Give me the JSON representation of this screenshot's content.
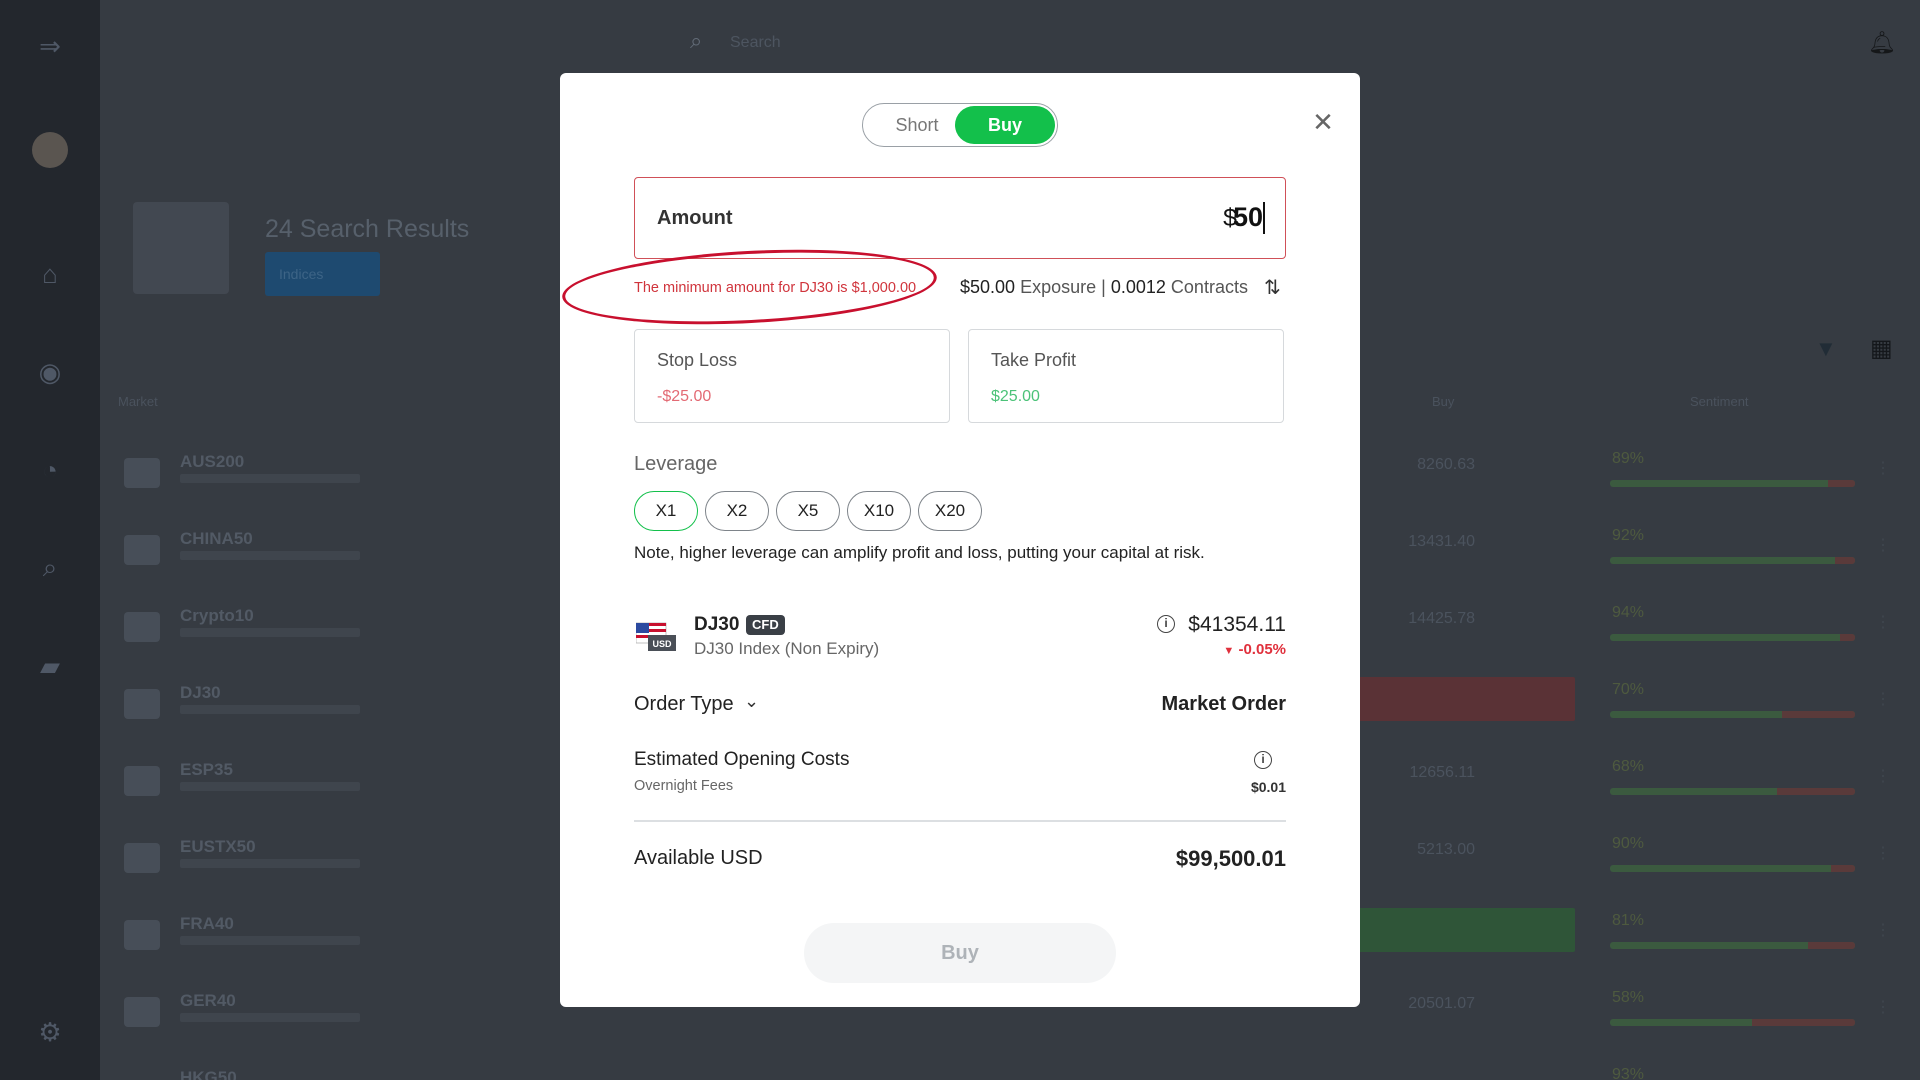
{
  "background": {
    "search_placeholder": "Search",
    "results_title": "24 Search Results",
    "indices_filter": "Indices",
    "column_headers": [
      "Market",
      "Buy",
      "Sentiment"
    ],
    "rows": [
      {
        "symbol": "AUS200",
        "buy": "8260.63",
        "sentiment": "89%"
      },
      {
        "symbol": "CHINA50",
        "buy": "13431.40",
        "sentiment": "92%"
      },
      {
        "symbol": "Crypto10",
        "buy": "14425.78",
        "sentiment": "94%"
      },
      {
        "symbol": "DJ30",
        "buy": "",
        "sentiment": "70%"
      },
      {
        "symbol": "ESP35",
        "buy": "12656.11",
        "sentiment": "68%"
      },
      {
        "symbol": "EUSTX50",
        "buy": "5213.00",
        "sentiment": "90%"
      },
      {
        "symbol": "FRA40",
        "buy": "",
        "sentiment": "81%"
      },
      {
        "symbol": "GER40",
        "buy": "20501.07",
        "sentiment": "58%"
      },
      {
        "symbol": "HKG50",
        "buy": "",
        "sentiment": "93%"
      }
    ]
  },
  "modal": {
    "toggle": {
      "short_label": "Short",
      "buy_label": "Buy",
      "selected": "Buy"
    },
    "amount": {
      "label": "Amount",
      "currency": "$",
      "value": "50"
    },
    "error_message": "The minimum amount for DJ30 is $1,000.00",
    "exposure": {
      "amount": "$50.00",
      "exposure_label": "Exposure",
      "separator": "|",
      "contracts": "0.0012",
      "contracts_label": "Contracts"
    },
    "stop_loss": {
      "label": "Stop Loss",
      "value": "-$25.00"
    },
    "take_profit": {
      "label": "Take Profit",
      "value": "$25.00"
    },
    "leverage": {
      "label": "Leverage",
      "options": [
        "X1",
        "X2",
        "X5",
        "X10",
        "X20"
      ],
      "selected": "X1",
      "note": "Note, higher leverage can amplify profit and loss, putting your capital at risk."
    },
    "instrument": {
      "symbol": "DJ30",
      "badge": "CFD",
      "name": "DJ30 Index (Non Expiry)",
      "price": "$41354.11",
      "change": "-0.05%",
      "flag_text": "USD"
    },
    "order_type": {
      "label": "Order Type",
      "value": "Market Order"
    },
    "opening_costs": {
      "label": "Estimated Opening Costs",
      "sub_label": "Overnight Fees",
      "value": "$0.01"
    },
    "available": {
      "label": "Available USD",
      "value": "$99,500.01"
    },
    "submit_label": "Buy"
  },
  "colors": {
    "accent_green": "#13c04b",
    "error_red": "#d0343c",
    "annotation_red": "#c8102e"
  }
}
